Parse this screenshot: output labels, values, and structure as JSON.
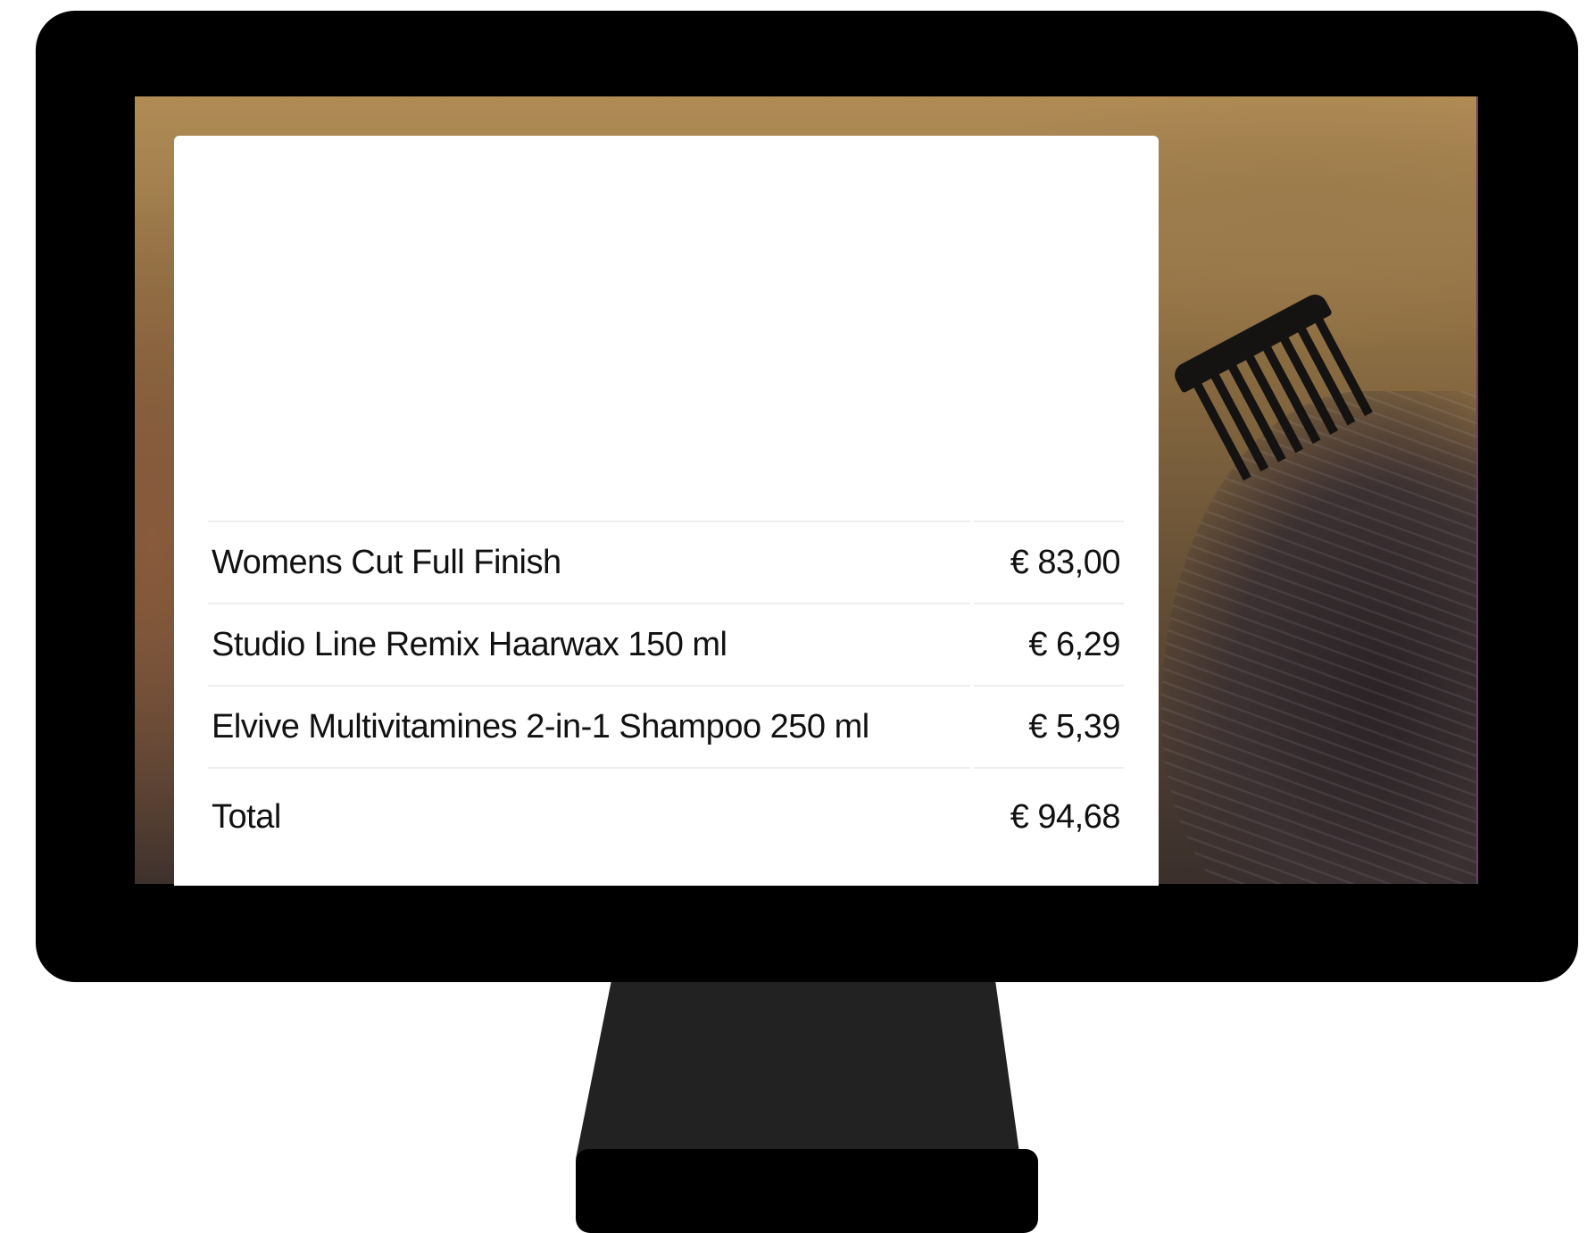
{
  "receipt": {
    "items": [
      {
        "name": "Womens Cut Full Finish",
        "price": "€ 83,00"
      },
      {
        "name": "Studio Line Remix Haarwax 150 ml",
        "price": "€ 6,29"
      },
      {
        "name": "Elvive Multivitamines 2-in-1 Shampoo 250 ml",
        "price": "€ 5,39"
      }
    ],
    "total_label": "Total",
    "total_value": "€ 94,68"
  },
  "colors": {
    "bezel": "#000000",
    "stand": "#222222",
    "card": "#ffffff",
    "row_divider": "#eeeeee",
    "text": "#111111"
  },
  "icons": {
    "background": "barber-photo-comb-hair"
  }
}
